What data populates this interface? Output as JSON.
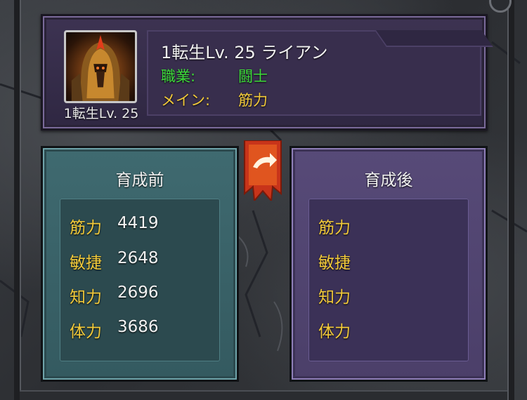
{
  "hero": {
    "name_line": "1転生Lv. 25 ライアン",
    "portrait_level": "1転生Lv. 25",
    "job_label": "職業:",
    "job_value": "闘士",
    "main_label": "メイン:",
    "main_value": "筋力"
  },
  "before": {
    "title": "育成前",
    "stats": [
      {
        "label": "筋力",
        "value": "4419"
      },
      {
        "label": "敏捷",
        "value": "2648"
      },
      {
        "label": "知力",
        "value": "2696"
      },
      {
        "label": "体力",
        "value": "3686"
      }
    ]
  },
  "after": {
    "title": "育成後",
    "stats": [
      {
        "label": "筋力",
        "value": ""
      },
      {
        "label": "敏捷",
        "value": ""
      },
      {
        "label": "知力",
        "value": ""
      },
      {
        "label": "体力",
        "value": ""
      }
    ]
  },
  "icons": {
    "portrait": "warrior-helmet-portrait",
    "ribbon": "arrow-ribbon-icon"
  },
  "colors": {
    "job": "#3ddc3a",
    "stat_label": "#f1c93a",
    "before_panel": "#3f6a70",
    "after_panel": "#574a78",
    "ribbon": "#d8441c"
  }
}
